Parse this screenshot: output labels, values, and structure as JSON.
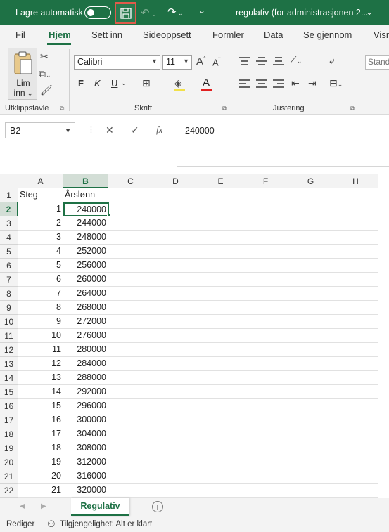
{
  "titlebar": {
    "autosave_label": "Lagre automatisk",
    "document_title": "regulativ (for administrasjonen 2...",
    "brand_color": "#1e7145"
  },
  "tabs": [
    "Fil",
    "Hjem",
    "Sett inn",
    "Sideoppsett",
    "Formler",
    "Data",
    "Se gjennom",
    "Visn"
  ],
  "active_tab": "Hjem",
  "ribbon": {
    "paste_label_1": "Lim",
    "paste_label_2": "inn",
    "font_name": "Calibri",
    "font_size": "11",
    "bold": "F",
    "italic": "K",
    "underline": "U",
    "number_format": "Stand",
    "groups": {
      "clipboard": "Utklippstavle",
      "font": "Skrift",
      "alignment": "Justering"
    }
  },
  "formula_bar": {
    "name_box": "B2",
    "formula": "240000"
  },
  "columns": [
    "A",
    "B",
    "C",
    "D",
    "E",
    "F",
    "G",
    "H"
  ],
  "selected_column": "B",
  "selected_row": 2,
  "header_row": {
    "a": "Steg",
    "b": "Årslønn"
  },
  "rows": [
    {
      "row": "2",
      "a": "1",
      "b": "240000"
    },
    {
      "row": "3",
      "a": "2",
      "b": "244000"
    },
    {
      "row": "4",
      "a": "3",
      "b": "248000"
    },
    {
      "row": "5",
      "a": "4",
      "b": "252000"
    },
    {
      "row": "6",
      "a": "5",
      "b": "256000"
    },
    {
      "row": "7",
      "a": "6",
      "b": "260000"
    },
    {
      "row": "8",
      "a": "7",
      "b": "264000"
    },
    {
      "row": "9",
      "a": "8",
      "b": "268000"
    },
    {
      "row": "10",
      "a": "9",
      "b": "272000"
    },
    {
      "row": "11",
      "a": "10",
      "b": "276000"
    },
    {
      "row": "12",
      "a": "11",
      "b": "280000"
    },
    {
      "row": "13",
      "a": "12",
      "b": "284000"
    },
    {
      "row": "14",
      "a": "13",
      "b": "288000"
    },
    {
      "row": "15",
      "a": "14",
      "b": "292000"
    },
    {
      "row": "16",
      "a": "15",
      "b": "296000"
    },
    {
      "row": "17",
      "a": "16",
      "b": "300000"
    },
    {
      "row": "18",
      "a": "17",
      "b": "304000"
    },
    {
      "row": "19",
      "a": "18",
      "b": "308000"
    },
    {
      "row": "20",
      "a": "19",
      "b": "312000"
    },
    {
      "row": "21",
      "a": "20",
      "b": "316000"
    },
    {
      "row": "22",
      "a": "21",
      "b": "320000"
    }
  ],
  "sheet_tab": "Regulativ",
  "status": {
    "mode": "Rediger",
    "accessibility": "Tilgjengelighet: Alt er klart"
  }
}
